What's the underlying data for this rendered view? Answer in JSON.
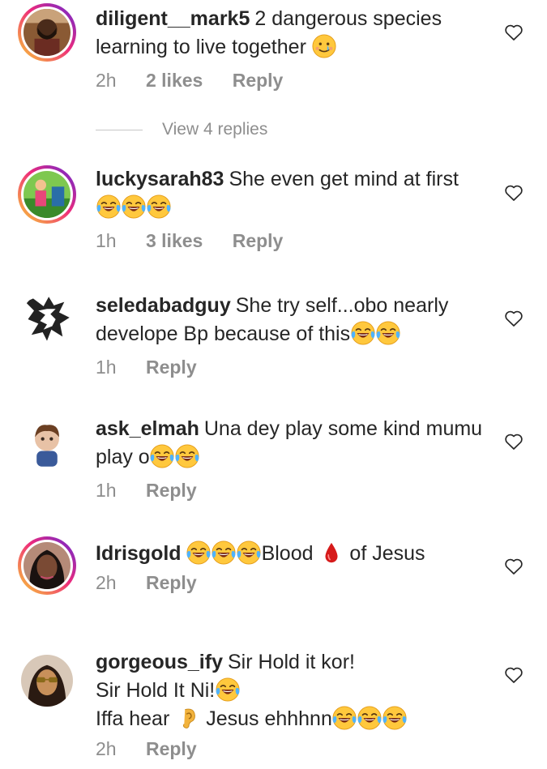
{
  "comments": [
    {
      "username": "diligent__mark5",
      "text": "2 dangerous species learning to live together",
      "time": "2h",
      "likes": "2 likes",
      "reply": "Reply"
    },
    {
      "username": "luckysarah83",
      "text": "She even get mind at first",
      "time": "1h",
      "likes": "3 likes",
      "reply": "Reply"
    },
    {
      "username": "seledabadguy",
      "text": "She try self...obo nearly develope Bp because of this",
      "time": "1h",
      "reply": "Reply"
    },
    {
      "username": "ask_elmah",
      "text": "Una dey play some kind mumu play o",
      "time": "1h",
      "reply": "Reply"
    },
    {
      "username": "Idrisgold",
      "text_a": "Blood",
      "text_b": "of Jesus",
      "time": "2h",
      "reply": "Reply"
    },
    {
      "username": "gorgeous_ify",
      "line1": "Sir Hold it kor!",
      "line2": "Sir Hold It Ni!",
      "line3_a": "Iffa hear",
      "line3_b": "Jesus ehhhnn",
      "time": "2h",
      "reply": "Reply"
    }
  ],
  "view_replies": "View 4 replies",
  "icons": {
    "heart": "heart-outline-icon",
    "laugh": "face-with-tears-of-joy-emoji",
    "cry": "smiling-face-with-tear-emoji",
    "blood": "drop-of-blood-emoji",
    "ear": "ear-emoji"
  },
  "colors": {
    "text": "#262626",
    "muted": "#8e8e8e",
    "ring_start": "#f9ce34",
    "ring_mid": "#ee2a7b",
    "ring_end": "#6228d7"
  }
}
